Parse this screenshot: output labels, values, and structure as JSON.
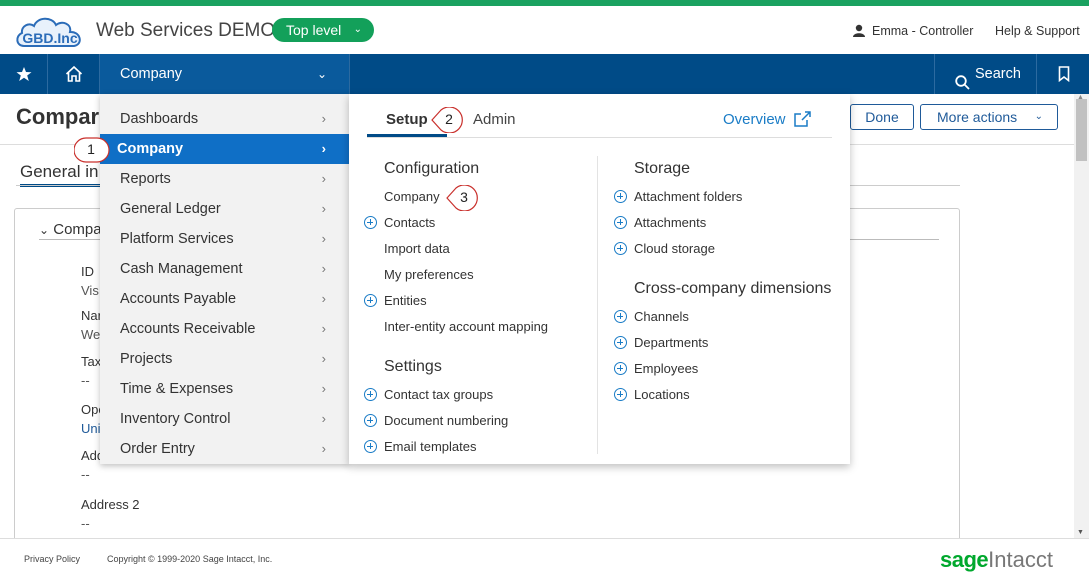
{
  "header": {
    "logo_text": "GBD.Inc",
    "app_title": "Web Services DEMO",
    "level_button": "Top level",
    "user": "Emma - Controller",
    "help": "Help & Support"
  },
  "nav": {
    "module": "Company",
    "search": "Search"
  },
  "page": {
    "title": "Compar",
    "done": "Done",
    "more_actions": "More actions",
    "tab_general": "General in",
    "section": "Compa",
    "fields": [
      {
        "label": "ID",
        "value": "Vis"
      },
      {
        "label": "Nar",
        "value": "We"
      },
      {
        "label": "Tax",
        "value": "--"
      },
      {
        "label": "Ope",
        "value": "Uni"
      },
      {
        "label": "Add",
        "value": "--"
      },
      {
        "label": "Address 2",
        "value": "--"
      }
    ]
  },
  "menu": {
    "items": [
      "Dashboards",
      "Company",
      "Reports",
      "General Ledger",
      "Platform Services",
      "Cash Management",
      "Accounts Payable",
      "Accounts Receivable",
      "Projects",
      "Time & Expenses",
      "Inventory Control",
      "Order Entry"
    ],
    "active_index": 1
  },
  "flyout": {
    "tabs": {
      "setup": "Setup",
      "admin": "Admin"
    },
    "overview": "Overview",
    "configuration": {
      "title": "Configuration",
      "links": [
        {
          "label": "Company",
          "plus": false
        },
        {
          "label": "Contacts",
          "plus": true
        },
        {
          "label": "Import data",
          "plus": false
        },
        {
          "label": "My preferences",
          "plus": false
        },
        {
          "label": "Entities",
          "plus": true
        },
        {
          "label": "Inter-entity account mapping",
          "plus": false
        }
      ]
    },
    "settings": {
      "title": "Settings",
      "links": [
        {
          "label": "Contact tax groups",
          "plus": true
        },
        {
          "label": "Document numbering",
          "plus": true
        },
        {
          "label": "Email templates",
          "plus": true
        }
      ]
    },
    "storage": {
      "title": "Storage",
      "links": [
        {
          "label": "Attachment folders",
          "plus": true
        },
        {
          "label": "Attachments",
          "plus": true
        },
        {
          "label": "Cloud storage",
          "plus": true
        }
      ]
    },
    "cross_company": {
      "title": "Cross-company dimensions",
      "links": [
        {
          "label": "Channels",
          "plus": true
        },
        {
          "label": "Departments",
          "plus": true
        },
        {
          "label": "Employees",
          "plus": true
        },
        {
          "label": "Locations",
          "plus": true
        }
      ]
    }
  },
  "callouts": [
    "1",
    "2",
    "3"
  ],
  "footer": {
    "privacy": "Privacy Policy",
    "copyright": "Copyright © 1999-2020 Sage Intacct, Inc.",
    "brand_sage": "sage",
    "brand_intacct": "Intacct"
  },
  "colors": {
    "brand_green": "#1aa260",
    "nav_blue": "#004b87",
    "active_blue": "#0f6fc6",
    "link_blue": "#1a7cc6"
  }
}
